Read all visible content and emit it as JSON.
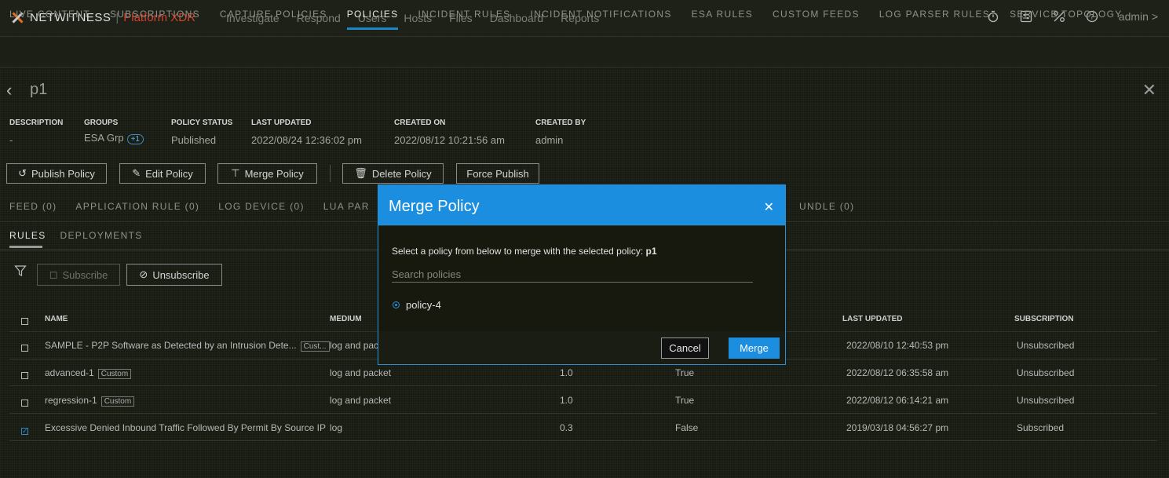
{
  "header": {
    "brand_name": "NETWITNESS",
    "brand_sep": "|",
    "brand_product": "Platform XDR",
    "nav": [
      "Investigate",
      "Respond",
      "Users",
      "Hosts",
      "Files",
      "Dashboard",
      "Reports"
    ],
    "user": "admin >"
  },
  "subnav": [
    "LIVE CONTENT",
    "SUBSCRIPTIONS",
    "CAPTURE POLICIES",
    "POLICIES",
    "INCIDENT RULES",
    "INCIDENT NOTIFICATIONS",
    "ESA RULES",
    "CUSTOM FEEDS",
    "LOG PARSER RULES",
    "SERVICE TOPOLOGY"
  ],
  "subnav_active": "POLICIES",
  "policy": {
    "title": "p1",
    "description_label": "DESCRIPTION",
    "description": "-",
    "groups_label": "GROUPS",
    "groups": "ESA Grp",
    "groups_more": "+1",
    "status_label": "POLICY STATUS",
    "status": "Published",
    "updated_label": "LAST UPDATED",
    "updated": "2022/08/24 12:36:02 pm",
    "created_label": "CREATED ON",
    "created": "2022/08/12 10:21:56 am",
    "createdby_label": "CREATED BY",
    "createdby": "admin"
  },
  "actions": {
    "publish": "Publish Policy",
    "edit": "Edit Policy",
    "merge": "Merge Policy",
    "delete": "Delete Policy",
    "force": "Force Publish"
  },
  "content_tabs": {
    "feed": "FEED (0)",
    "app_rule": "APPLICATION RULE (0)",
    "log_device": "LOG DEVICE (0)",
    "lua": "LUA PAR",
    "bundle": "UNDLE (0)"
  },
  "rule_tabs": [
    "RULES",
    "DEPLOYMENTS"
  ],
  "toolbar": {
    "subscribe": "Subscribe",
    "unsubscribe": "Unsubscribe"
  },
  "table": {
    "headers": {
      "name": "NAME",
      "medium": "MEDIUM",
      "last_updated": "LAST UPDATED",
      "subscription": "SUBSCRIPTION"
    },
    "rows": [
      {
        "name": "SAMPLE - P2P Software as Detected by an Intrusion Dete...",
        "tag": "Cust...",
        "medium": "log and pack",
        "version": "",
        "enabled": "",
        "updated": "2022/08/10 12:40:53 pm",
        "subscription": "Unsubscribed",
        "checked": false
      },
      {
        "name": "advanced-1",
        "tag": "Custom",
        "medium": "log and packet",
        "version": "1.0",
        "enabled": "True",
        "updated": "2022/08/12 06:35:58 am",
        "subscription": "Unsubscribed",
        "checked": false
      },
      {
        "name": "regression-1",
        "tag": "Custom",
        "medium": "log and packet",
        "version": "1.0",
        "enabled": "True",
        "updated": "2022/08/12 06:14:21 am",
        "subscription": "Unsubscribed",
        "checked": false
      },
      {
        "name": "Excessive Denied Inbound Traffic Followed By Permit By Source IP",
        "tag": "",
        "medium": "log",
        "version": "0.3",
        "enabled": "False",
        "updated": "2019/03/18 04:56:27 pm",
        "subscription": "Subscribed",
        "checked": true
      }
    ]
  },
  "modal": {
    "title": "Merge Policy",
    "instruction": "Select a policy from below to merge with the selected policy:",
    "selected_policy": "p1",
    "search_placeholder": "Search policies",
    "option": "policy-4",
    "cancel": "Cancel",
    "merge": "Merge"
  },
  "icons": [
    "close-icon",
    "back-chevron-icon",
    "refresh-icon",
    "edit-icon",
    "merge-icon",
    "trash-icon",
    "filter-icon",
    "bell-icon",
    "bell-off-icon",
    "timer-icon",
    "settings-panel-icon",
    "tools-icon",
    "help-icon",
    "checkbox-icon",
    "radio-icon"
  ],
  "colors": {
    "accent": "#1b8ee0",
    "brand_orange": "#e86c1f",
    "xdr_red": "#d4412c"
  }
}
